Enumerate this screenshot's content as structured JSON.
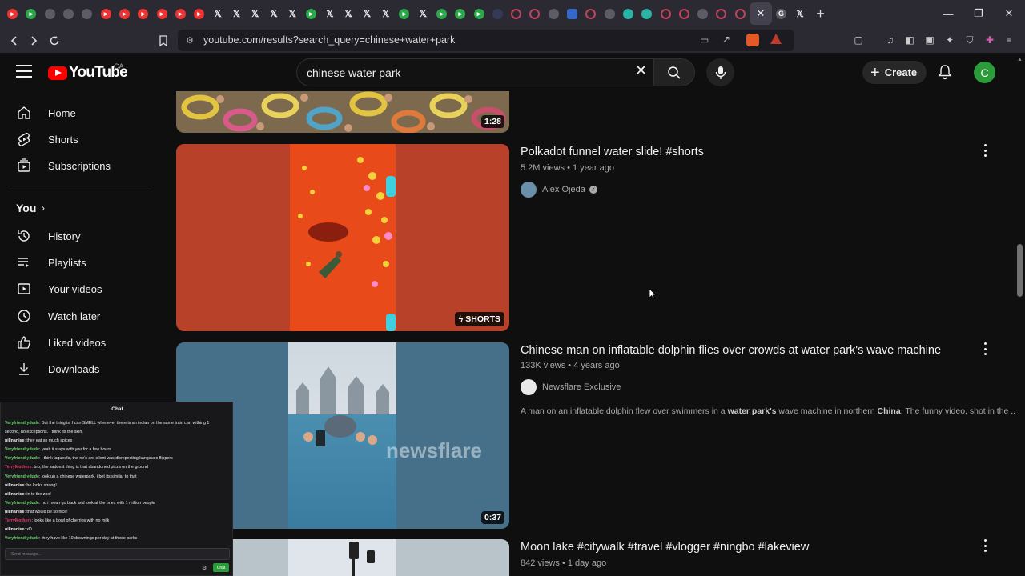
{
  "browser": {
    "url": "youtube.com/results?search_query=chinese+water+park",
    "tabs": [
      "yt",
      "g",
      "gray",
      "gray",
      "gray",
      "yt",
      "yt",
      "yt",
      "yt",
      "yt",
      "yt",
      "x",
      "x",
      "x",
      "x",
      "x",
      "g",
      "x",
      "x",
      "x",
      "x",
      "g",
      "x",
      "g",
      "g",
      "g",
      "dark",
      "ring",
      "ring",
      "gray",
      "blue",
      "ring",
      "gray",
      "teal",
      "teal",
      "ring",
      "ring",
      "gray",
      "ring",
      "ring"
    ],
    "window_controls": {
      "minimize": "—",
      "restore": "❐",
      "close": "✕"
    },
    "new_tab": "+"
  },
  "masthead": {
    "logo_text": "YouTube",
    "country": "CA",
    "search_value": "chinese water park",
    "create_label": "Create",
    "avatar_letter": "C",
    "accent": "#ff0000"
  },
  "sidebar": {
    "main": [
      {
        "label": "Home",
        "icon": "home-icon"
      },
      {
        "label": "Shorts",
        "icon": "shorts-icon"
      },
      {
        "label": "Subscriptions",
        "icon": "subscriptions-icon"
      }
    ],
    "you_header": "You",
    "you": [
      {
        "label": "History",
        "icon": "history-icon"
      },
      {
        "label": "Playlists",
        "icon": "playlists-icon"
      },
      {
        "label": "Your videos",
        "icon": "your-videos-icon"
      },
      {
        "label": "Watch later",
        "icon": "watch-later-icon"
      },
      {
        "label": "Liked videos",
        "icon": "liked-icon"
      },
      {
        "label": "Downloads",
        "icon": "downloads-icon"
      }
    ]
  },
  "results": [
    {
      "duration": "1:28"
    },
    {
      "title": "Polkadot funnel water slide! #shorts",
      "meta": "5.2M views • 1 year ago",
      "channel": "Alex Ojeda",
      "verified": true,
      "badge": "SHORTS"
    },
    {
      "title": "Chinese man on inflatable dolphin flies over crowds at water park's wave machine",
      "meta": "133K views • 4 years ago",
      "channel": "Newsflare Exclusive",
      "desc_parts": [
        "A man on an inflatable dolphin flew over swimmers in a ",
        "water park's",
        " wave machine in northern ",
        "China",
        ". The funny video, shot in the ..."
      ],
      "duration": "0:37",
      "watermark": "newsflare"
    },
    {
      "title": "Moon lake #citywalk #travel #vlogger #ningbo #lakeview",
      "meta": "842 views • 1 day ago"
    }
  ],
  "chat": {
    "title": "Chat",
    "input_placeholder": "Send message...",
    "send_label": "Chat",
    "lines": [
      {
        "user": "Veryfriendlydude",
        "color": "#6ad06a",
        "text": "But the thing is, I can SMELL whenever there is an indian on the same train cart withing 1"
      },
      {
        "user": "",
        "color": "#efeff1",
        "text": "second, no exceptions. I think its the skin."
      },
      {
        "user": "nilinanise",
        "color": "#efeff1",
        "text": "they eat so much spices"
      },
      {
        "user": "Veryfriendlydude",
        "color": "#6ad06a",
        "text": "yeah it stays with you for a few hours"
      },
      {
        "user": "Veryfriendlydude",
        "color": "#6ad06a",
        "text": "i think laqueefa, the ne's are silent was disrepecting kangaues flippers"
      },
      {
        "user": "TerryMothers",
        "color": "#e0406a",
        "text": "bro, the saddest thing is that abandoned pizza on the ground"
      },
      {
        "user": "Veryfriendlydude",
        "color": "#6ad06a",
        "text": "look up a chinese waterpark, i bet its similar to that"
      },
      {
        "user": "nilinanise",
        "color": "#efeff1",
        "text": "he looks strong!"
      },
      {
        "user": "nilinanise",
        "color": "#efeff1",
        "text": "in to the zoo!"
      },
      {
        "user": "Veryfriendlydude",
        "color": "#6ad06a",
        "text": "no i mean go back and look at the ones with 1 million people"
      },
      {
        "user": "nilinanise",
        "color": "#efeff1",
        "text": "that would be so nice!"
      },
      {
        "user": "TerryMothers",
        "color": "#e0406a",
        "text": "looks like a bowl of cherrios with no milk"
      },
      {
        "user": "nilinanise",
        "color": "#efeff1",
        "text": "xD"
      },
      {
        "user": "Veryfriendlydude",
        "color": "#6ad06a",
        "text": "they have like 10 drownings per day at these parks"
      }
    ]
  }
}
